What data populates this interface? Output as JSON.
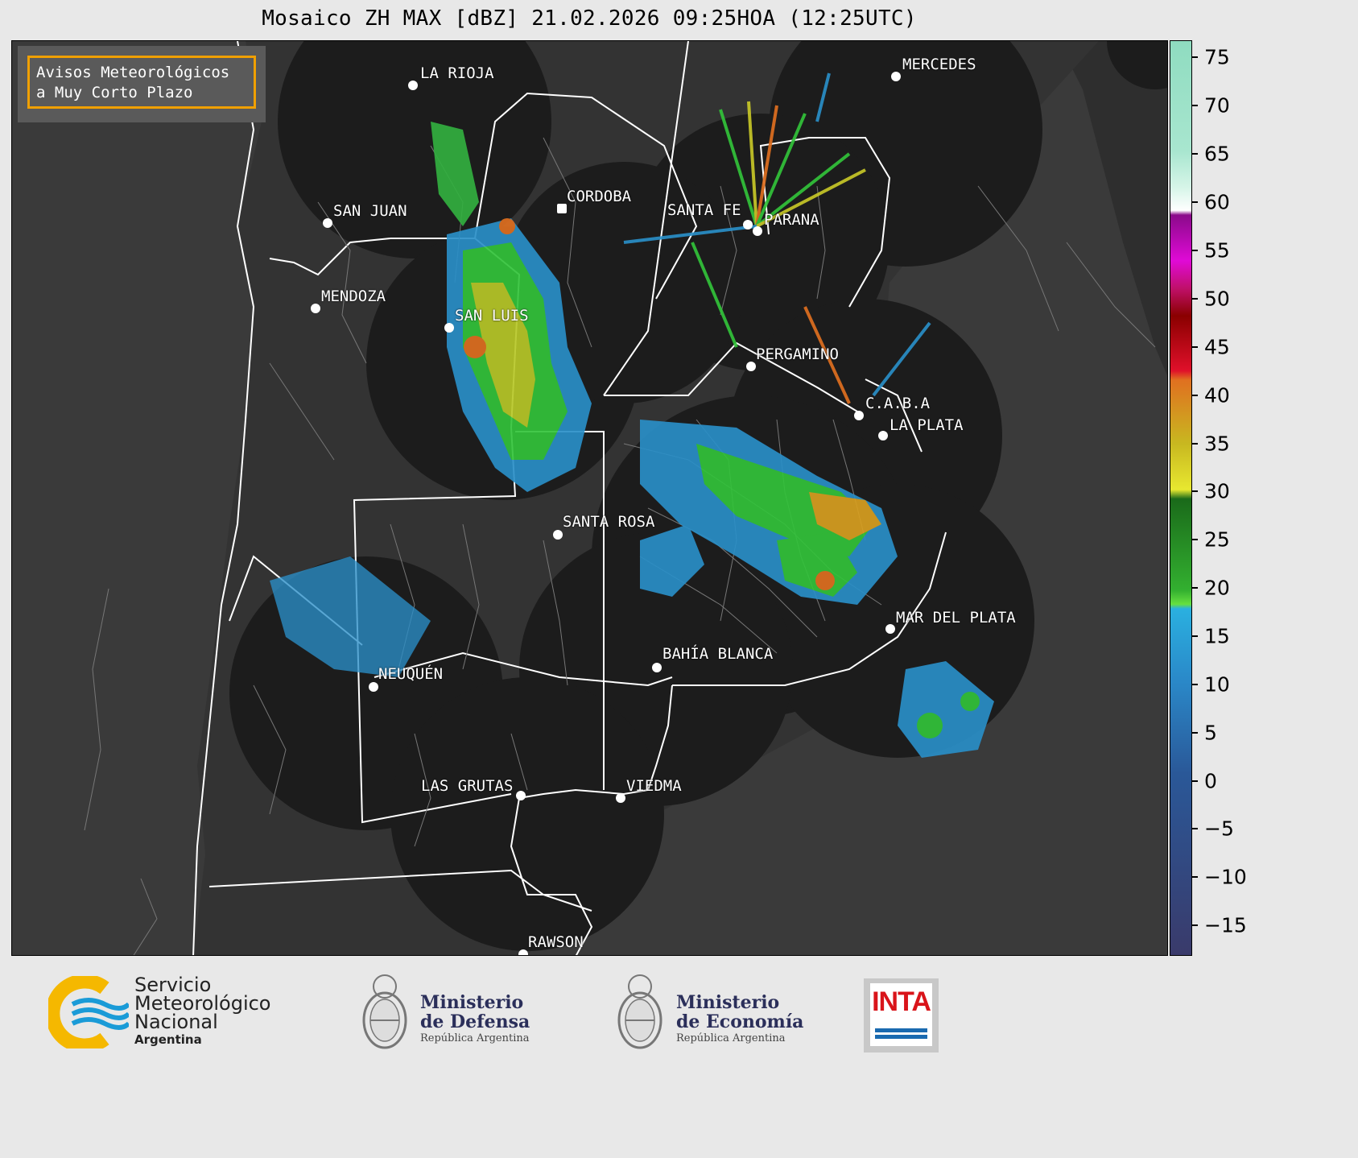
{
  "title": "Mosaico ZH MAX [dBZ] 21.02.2026 09:25HOA (12:25UTC)",
  "avisos": {
    "line1": "Avisos Meteorológicos",
    "line2": "a Muy Corto Plazo"
  },
  "cities": [
    {
      "name": "LA RIOJA"
    },
    {
      "name": "MERCEDES"
    },
    {
      "name": "CORDOBA"
    },
    {
      "name": "SAN JUAN"
    },
    {
      "name": "SANTA FE"
    },
    {
      "name": "PARANA"
    },
    {
      "name": "MENDOZA"
    },
    {
      "name": "SAN LUIS"
    },
    {
      "name": "PERGAMINO"
    },
    {
      "name": "C.A.B.A"
    },
    {
      "name": "LA PLATA"
    },
    {
      "name": "SANTA ROSA"
    },
    {
      "name": "MAR DEL PLATA"
    },
    {
      "name": "BAHÍA BLANCA"
    },
    {
      "name": "NEUQUÉN"
    },
    {
      "name": "LAS GRUTAS"
    },
    {
      "name": "VIEDMA"
    },
    {
      "name": "RAWSON"
    }
  ],
  "colorbar": {
    "unit": "dBZ",
    "ticks": [
      "75",
      "70",
      "65",
      "60",
      "55",
      "50",
      "45",
      "40",
      "35",
      "30",
      "25",
      "20",
      "15",
      "10",
      "5",
      "0",
      "−5",
      "−10",
      "−15"
    ]
  },
  "logos": {
    "smn": {
      "line1": "Servicio",
      "line2": "Meteorológico",
      "line3": "Nacional",
      "country": "Argentina"
    },
    "defensa": {
      "line1": "Ministerio",
      "line2": "de Defensa",
      "line3": "República Argentina"
    },
    "economia": {
      "line1": "Ministerio",
      "line2": "de Economía",
      "line3": "República Argentina"
    },
    "inta": {
      "text": "INTA"
    }
  },
  "colors": {
    "background": "#e8e8e8",
    "sea": "#3a3a3a",
    "radar_coverage": "#1c1c1c",
    "avisos_border": "#f0a000",
    "inta_red": "#d9141a",
    "smn_blue": "#1a9bd7",
    "smn_yellow": "#f5b800"
  }
}
